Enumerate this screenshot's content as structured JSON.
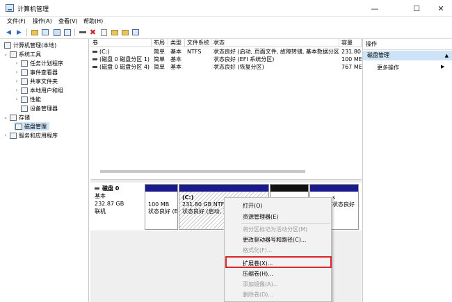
{
  "window": {
    "title": "计算机管理",
    "minimize": "—",
    "maximize": "☐",
    "close": "✕"
  },
  "menu": [
    "文件(F)",
    "操作(A)",
    "查看(V)",
    "帮助(H)"
  ],
  "toolbar": {
    "back": "◀",
    "forward": "▶",
    "delete": "✖"
  },
  "tree": {
    "root": "计算机管理(本地)",
    "system_tools": "系统工具",
    "task_scheduler": "任务计划程序",
    "event_viewer": "事件查看器",
    "shared_folders": "共享文件夹",
    "local_users": "本地用户和组",
    "performance": "性能",
    "device_manager": "设备管理器",
    "storage": "存储",
    "disk_management": "磁盘管理",
    "services": "服务和应用程序"
  },
  "volumes": {
    "columns": [
      "卷",
      "布局",
      "类型",
      "文件系统",
      "状态",
      "容量"
    ],
    "rows": [
      [
        "(C:)",
        "简单",
        "基本",
        "NTFS",
        "状态良好 (启动, 页面文件, 故障转储, 基本数据分区)",
        "231.80"
      ],
      [
        "(磁盘 0 磁盘分区 1)",
        "简单",
        "基本",
        "",
        "状态良好 (EFI 系统分区)",
        "100 ME"
      ],
      [
        "(磁盘 0 磁盘分区 4)",
        "简单",
        "基本",
        "",
        "状态良好 (恢复分区)",
        "767 ME"
      ]
    ]
  },
  "disk": {
    "name": "磁盘 0",
    "type": "基本",
    "size": "232.87 GB",
    "status": "联机"
  },
  "partitions": {
    "p1_size": "100 MB",
    "p1_status": "状态良好 (E",
    "c_label": "(C:)",
    "c_size": "231.80 GB NTFS",
    "c_status": "状态良好 (启动, 页",
    "p4_text": "s",
    "p4_status": "状态良好"
  },
  "actions": {
    "title": "操作",
    "section": "磁盘管理",
    "more": "更多操作"
  },
  "context_menu": {
    "open": "打开(O)",
    "explorer": "资源管理器(E)",
    "mark_active": "将分区标记为活动分区(M)",
    "change_letter": "更改驱动器号和路径(C)...",
    "format": "格式化(F)...",
    "extend": "扩展卷(X)...",
    "shrink": "压缩卷(H)...",
    "add_mirror": "添加镜像(A)...",
    "delete": "删除卷(D)..."
  }
}
